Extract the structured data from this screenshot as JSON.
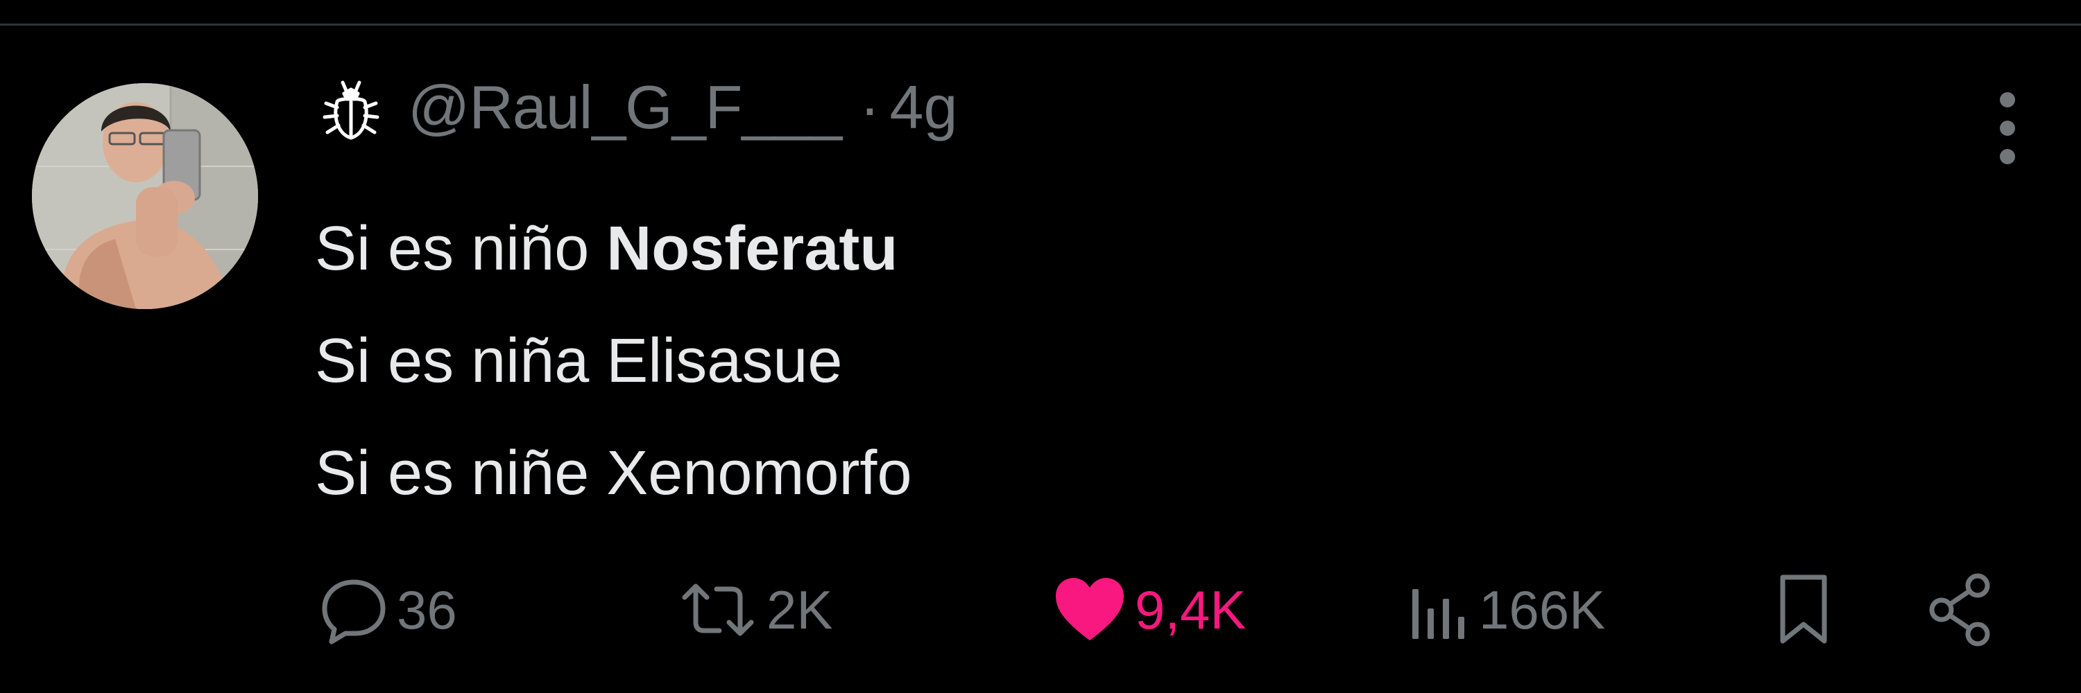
{
  "tweet": {
    "handle": "@Raul_G_F___",
    "separator": "·",
    "time": "4g",
    "lines": [
      {
        "prefix": "Si es niño ",
        "bold": "Nosferatu"
      },
      {
        "prefix": "Si es niña Elisasue",
        "bold": ""
      },
      {
        "prefix": "Si es niñe Xenomorfo",
        "bold": ""
      }
    ]
  },
  "actions": {
    "replies": "36",
    "retweets": "2K",
    "likes": "9,4K",
    "views": "166K"
  },
  "colors": {
    "background": "#000000",
    "text": "#e7e9ea",
    "muted": "#71767b",
    "like": "#f91880",
    "divider": "#2f3336"
  },
  "icons": {
    "profile_badge": "beetle-icon",
    "more": "more-vertical-icon",
    "reply": "reply-icon",
    "retweet": "retweet-icon",
    "like": "heart-icon",
    "views": "views-icon",
    "bookmark": "bookmark-icon",
    "share": "share-icon"
  }
}
